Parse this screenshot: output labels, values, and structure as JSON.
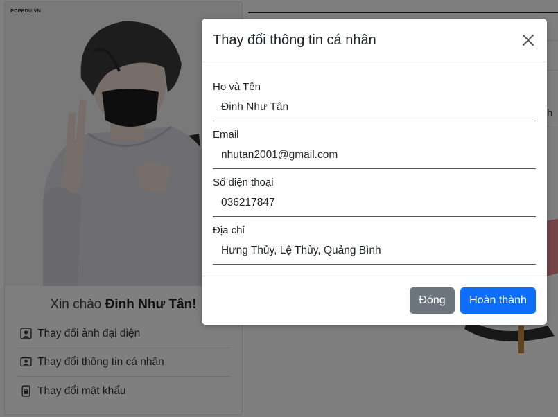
{
  "profile": {
    "watermark": "POPEDU.VN",
    "greeting_prefix": "Xin chào ",
    "user_name": "Đinh Như Tân!",
    "menu": [
      {
        "label": "Thay đổi ảnh đại diện",
        "icon": "person-square-icon"
      },
      {
        "label": "Thay đổi thông tin cá nhân",
        "icon": "person-vcard-icon"
      },
      {
        "label": "Thay đổi mật khẩu",
        "icon": "lock-file-icon"
      }
    ]
  },
  "background": {
    "partial_text": "h"
  },
  "modal": {
    "title": "Thay đổi thông tin cá nhân",
    "fields": [
      {
        "label": "Họ và Tên",
        "value": "Đinh Như Tân"
      },
      {
        "label": "Email",
        "value": "nhutan2001@gmail.com"
      },
      {
        "label": "Số điện thoại",
        "value": "036217847"
      },
      {
        "label": "Địa chỉ",
        "value": "Hưng Thủy, Lệ Thủy, Quảng Bình"
      }
    ],
    "close_label": "Đóng",
    "submit_label": "Hoàn thành"
  },
  "colors": {
    "primary": "#0d6efd",
    "secondary": "#6c757d"
  }
}
